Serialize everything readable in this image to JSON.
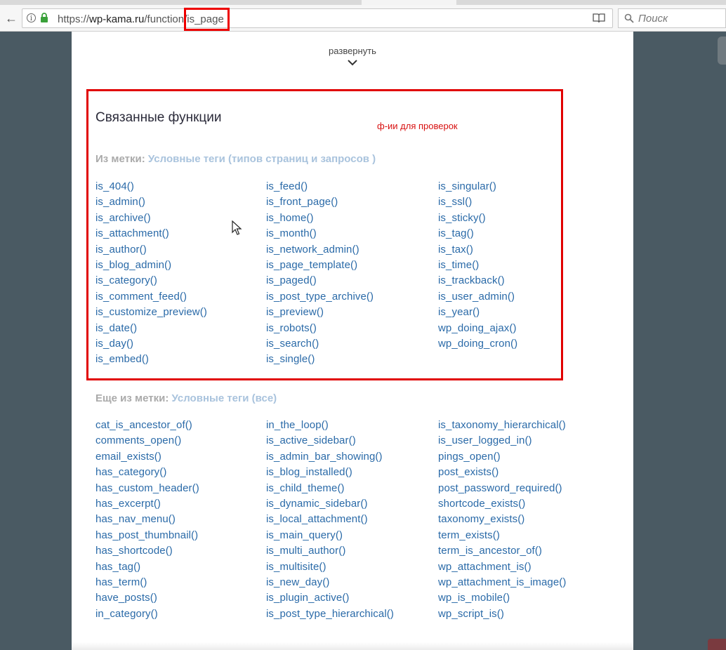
{
  "browser": {
    "url_prefix": "https://",
    "url_domain": "wp-kama.ru",
    "url_path": "/function/is_page",
    "search_placeholder": "Поиск"
  },
  "page": {
    "expand_label": "развернуть",
    "section_title": "Связанные функции",
    "note": "ф-ии для проверок",
    "tag_line_1": {
      "prefix": "Из метки:",
      "tag": "Условные теги (типов страниц и запросов )"
    },
    "tag_line_2": {
      "prefix": "Еще из метки:",
      "tag": "Условные теги (все)"
    },
    "group1": {
      "col1": [
        "is_404()",
        "is_admin()",
        "is_archive()",
        "is_attachment()",
        "is_author()",
        "is_blog_admin()",
        "is_category()",
        "is_comment_feed()",
        "is_customize_preview()",
        "is_date()",
        "is_day()",
        "is_embed()"
      ],
      "col2": [
        "is_feed()",
        "is_front_page()",
        "is_home()",
        "is_month()",
        "is_network_admin()",
        "is_page_template()",
        "is_paged()",
        "is_post_type_archive()",
        "is_preview()",
        "is_robots()",
        "is_search()",
        "is_single()"
      ],
      "col3": [
        "is_singular()",
        "is_ssl()",
        "is_sticky()",
        "is_tag()",
        "is_tax()",
        "is_time()",
        "is_trackback()",
        "is_user_admin()",
        "is_year()",
        "wp_doing_ajax()",
        "wp_doing_cron()"
      ]
    },
    "group2": {
      "col1": [
        "cat_is_ancestor_of()",
        "comments_open()",
        "email_exists()",
        "has_category()",
        "has_custom_header()",
        "has_excerpt()",
        "has_nav_menu()",
        "has_post_thumbnail()",
        "has_shortcode()",
        "has_tag()",
        "has_term()",
        "have_posts()",
        "in_category()"
      ],
      "col2": [
        "in_the_loop()",
        "is_active_sidebar()",
        "is_admin_bar_showing()",
        "is_blog_installed()",
        "is_child_theme()",
        "is_dynamic_sidebar()",
        "is_local_attachment()",
        "is_main_query()",
        "is_multi_author()",
        "is_multisite()",
        "is_new_day()",
        "is_plugin_active()",
        "is_post_type_hierarchical()"
      ],
      "col3": [
        "is_taxonomy_hierarchical()",
        "is_user_logged_in()",
        "pings_open()",
        "post_exists()",
        "post_password_required()",
        "shortcode_exists()",
        "taxonomy_exists()",
        "term_exists()",
        "term_is_ancestor_of()",
        "wp_attachment_is()",
        "wp_attachment_is_image()",
        "wp_is_mobile()",
        "wp_script_is()"
      ]
    }
  }
}
